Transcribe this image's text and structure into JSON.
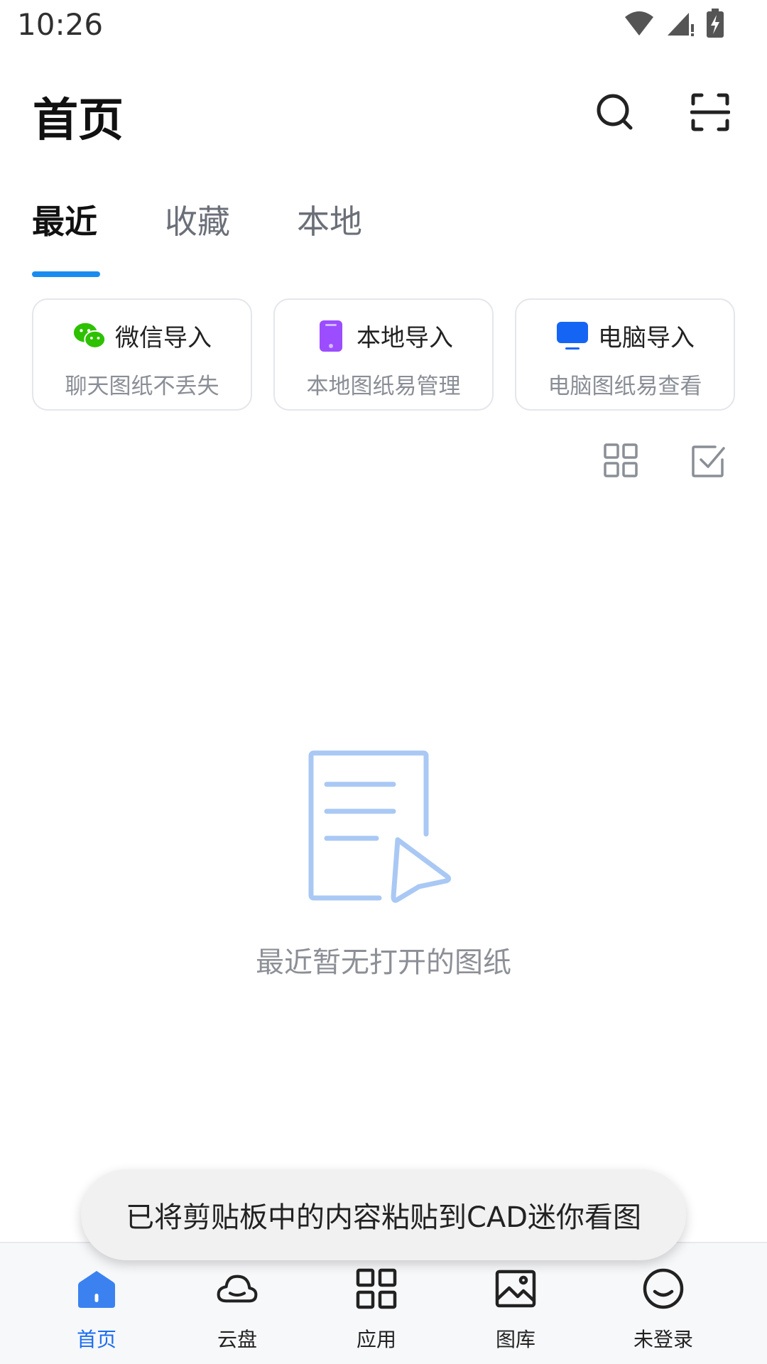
{
  "status_bar": {
    "time": "10:26",
    "icons": [
      "wifi-icon",
      "signal-icon",
      "battery-charging-icon"
    ]
  },
  "header": {
    "title": "首页",
    "search_icon": "search-icon",
    "scan_icon": "scan-icon"
  },
  "tabs": [
    {
      "label": "最近",
      "active": true
    },
    {
      "label": "收藏",
      "active": false
    },
    {
      "label": "本地",
      "active": false
    }
  ],
  "imports": [
    {
      "title": "微信导入",
      "subtitle": "聊天图纸不丢失",
      "icon": "wechat-icon",
      "color": "#2dc100"
    },
    {
      "title": "本地导入",
      "subtitle": "本地图纸易管理",
      "icon": "phone-icon",
      "color": "#9b4dff"
    },
    {
      "title": "电脑导入",
      "subtitle": "电脑图纸易查看",
      "icon": "monitor-icon",
      "color": "#1565f5"
    }
  ],
  "view_controls": {
    "grid_icon": "grid-view-icon",
    "select_icon": "checkbox-icon"
  },
  "empty_state": {
    "icon": "empty-document-icon",
    "message": "最近暂无打开的图纸"
  },
  "toast": {
    "message": "已将剪贴板中的内容粘贴到CAD迷你看图"
  },
  "bottom_nav": [
    {
      "label": "首页",
      "icon": "home-icon",
      "active": true
    },
    {
      "label": "云盘",
      "icon": "cloud-icon",
      "active": false
    },
    {
      "label": "应用",
      "icon": "apps-icon",
      "active": false
    },
    {
      "label": "图库",
      "icon": "gallery-icon",
      "active": false
    },
    {
      "label": "未登录",
      "icon": "user-face-icon",
      "active": false
    }
  ],
  "colors": {
    "accent": "#1a8cf0",
    "nav_active": "#1a6ef0",
    "illustration": "#a9c8f4"
  }
}
